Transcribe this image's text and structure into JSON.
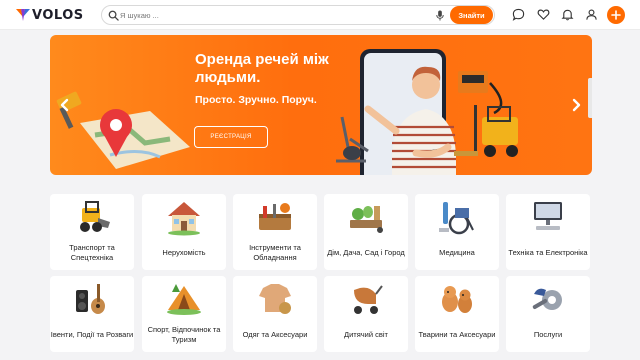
{
  "header": {
    "logo_text": "VOLOS",
    "search_placeholder": "Я шукаю ...",
    "search_button": "Знайти"
  },
  "banner": {
    "title": "Оренда речей між людьми.",
    "subtitle": "Просто. Зручно. Поруч.",
    "register_button": "РЕЄСТРАЦІЯ"
  },
  "categories": [
    {
      "label": "Транспорт та Спецтехніка",
      "icon": "loader-icon"
    },
    {
      "label": "Нерухомість",
      "icon": "house-icon"
    },
    {
      "label": "Інструменти та Обладнання",
      "icon": "toolbox-icon"
    },
    {
      "label": "Дім, Дача, Сад і Город",
      "icon": "garden-icon"
    },
    {
      "label": "Медицина",
      "icon": "wheelchair-icon"
    },
    {
      "label": "Техніка та Електроніка",
      "icon": "computer-icon"
    },
    {
      "label": "Івенти, Події та Розваги",
      "icon": "guitar-icon"
    },
    {
      "label": "Спорт, Відпочинок та Туризм",
      "icon": "tent-icon"
    },
    {
      "label": "Одяг та Аксесуари",
      "icon": "tshirt-icon"
    },
    {
      "label": "Дитячий світ",
      "icon": "stroller-icon"
    },
    {
      "label": "Тварини та Аксесуари",
      "icon": "dogs-icon"
    },
    {
      "label": "Послуги",
      "icon": "services-icon"
    }
  ],
  "colors": {
    "accent": "#ff6a00",
    "banner": "#ff7412"
  }
}
